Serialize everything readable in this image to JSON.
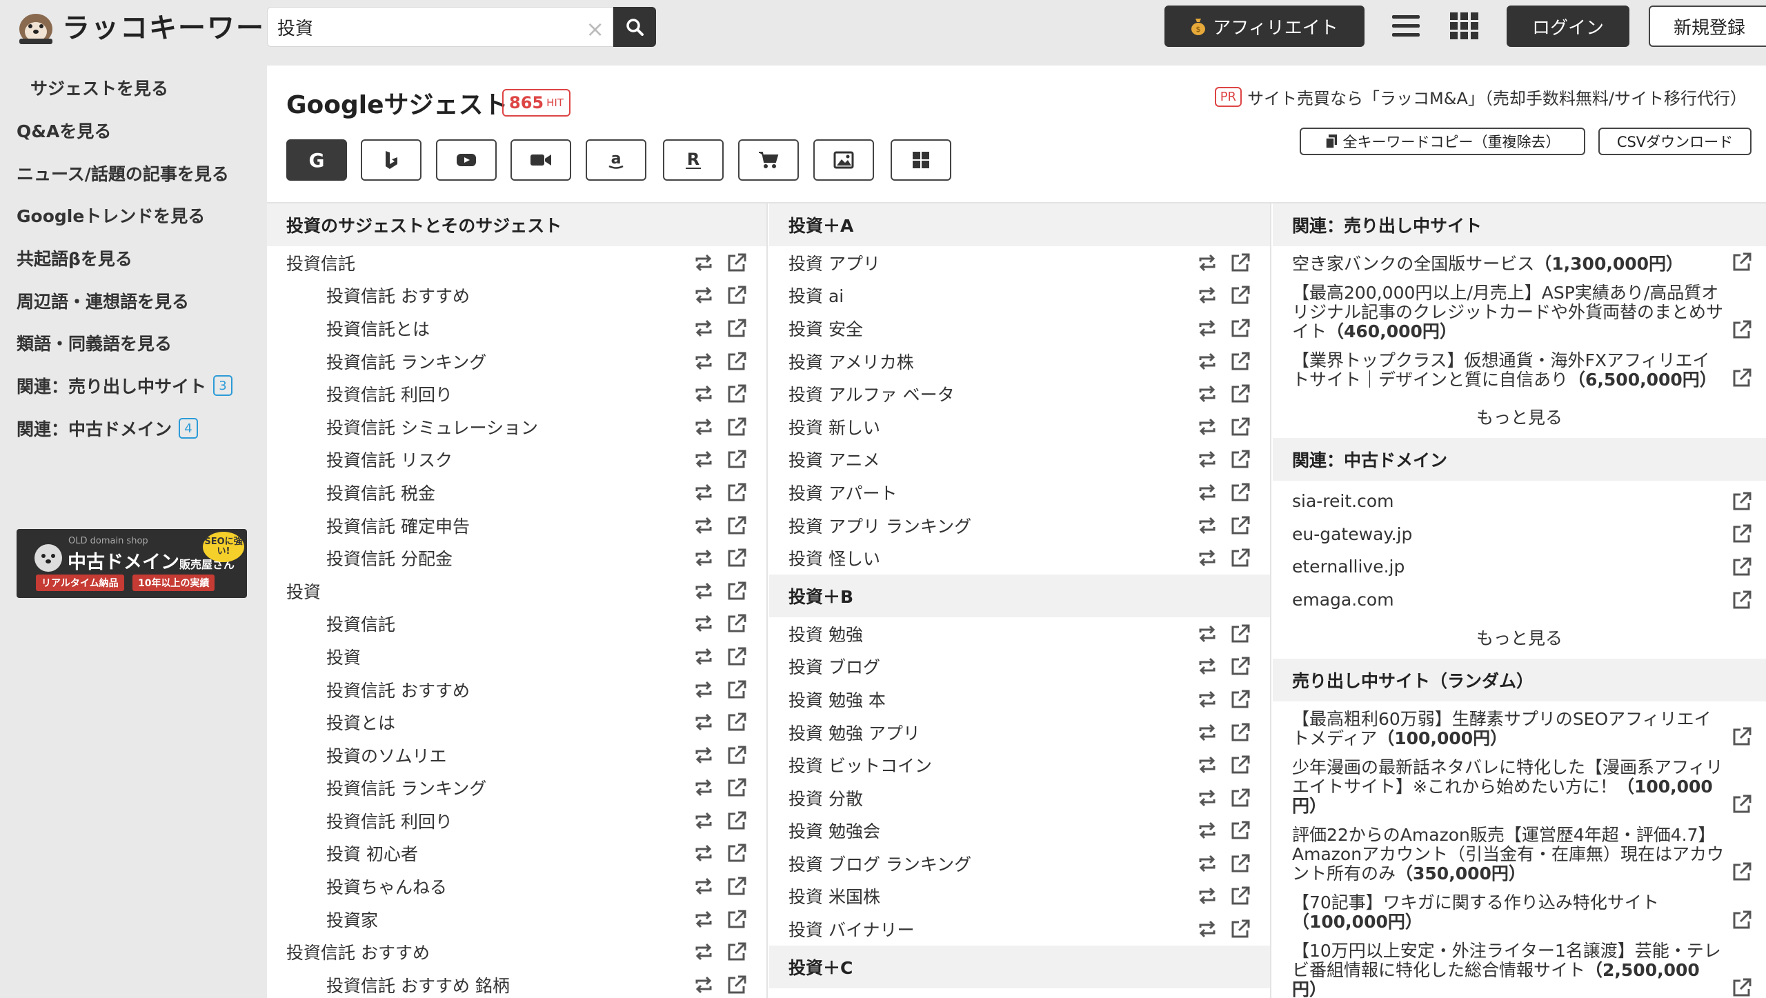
{
  "header": {
    "logo_text": "ラッコキーワード",
    "search_value": "投資",
    "affiliate_label": "アフィリエイト",
    "login_label": "ログイン",
    "signup_label": "新規登録"
  },
  "sidebar": {
    "items": [
      {
        "label": "サジェストを見る"
      },
      {
        "label": "Q&Aを見る"
      },
      {
        "label": "ニュース/話題の記事を見る"
      },
      {
        "label": "Googleトレンドを見る"
      },
      {
        "label": "共起語βを見る"
      },
      {
        "label": "周辺語・連想語を見る"
      },
      {
        "label": "類語・同義語を見る"
      },
      {
        "label": "関連：売り出し中サイト",
        "badge": "3"
      },
      {
        "label": "関連：中古ドメイン",
        "badge": "4"
      }
    ],
    "banner": {
      "sub": "OLD domain shop",
      "title": "中古ドメイン",
      "title_small": "販売屋さん",
      "seo": "SEOに強い!",
      "tag1": "リアルタイム納品",
      "tag2": "10年以上の実績"
    }
  },
  "main": {
    "title": "Googleサジェスト",
    "hit_count": "865",
    "hit_unit": "HIT",
    "pr_badge": "PR",
    "pr_text": "サイト売買なら「ラッコM&A」（売却手数料無料/サイト移行代行）",
    "copy_all_label": "全キーワードコピー（重複除去）",
    "csv_label": "CSVダウンロード",
    "engines": [
      "G",
      "b",
      "yt",
      "video",
      "a",
      "R",
      "cart",
      "image",
      "win"
    ]
  },
  "col1": {
    "heading": "投資のサジェストとそのサジェスト",
    "rows": [
      {
        "text": "投資信託",
        "sub": false
      },
      {
        "text": "投資信託 おすすめ",
        "sub": true
      },
      {
        "text": "投資信託とは",
        "sub": true
      },
      {
        "text": "投資信託 ランキング",
        "sub": true
      },
      {
        "text": "投資信託 利回り",
        "sub": true
      },
      {
        "text": "投資信託 シミュレーション",
        "sub": true
      },
      {
        "text": "投資信託 リスク",
        "sub": true
      },
      {
        "text": "投資信託 税金",
        "sub": true
      },
      {
        "text": "投資信託 確定申告",
        "sub": true
      },
      {
        "text": "投資信託 分配金",
        "sub": true
      },
      {
        "text": "投資",
        "sub": false
      },
      {
        "text": "投資信託",
        "sub": true
      },
      {
        "text": "投資",
        "sub": true
      },
      {
        "text": "投資信託 おすすめ",
        "sub": true
      },
      {
        "text": "投資とは",
        "sub": true
      },
      {
        "text": "投資のソムリエ",
        "sub": true
      },
      {
        "text": "投資信託 ランキング",
        "sub": true
      },
      {
        "text": "投資信託 利回り",
        "sub": true
      },
      {
        "text": "投資 初心者",
        "sub": true
      },
      {
        "text": "投資ちゃんねる",
        "sub": true
      },
      {
        "text": "投資家",
        "sub": true
      },
      {
        "text": "投資信託 おすすめ",
        "sub": false
      },
      {
        "text": "投資信託 おすすめ 銘柄",
        "sub": true
      }
    ]
  },
  "col2": {
    "sections": [
      {
        "heading": "投資＋A",
        "rows": [
          "投資 アプリ",
          "投資 ai",
          "投資 安全",
          "投資 アメリカ株",
          "投資 アルファ ベータ",
          "投資 新しい",
          "投資 アニメ",
          "投資 アパート",
          "投資 アプリ ランキング",
          "投資 怪しい"
        ]
      },
      {
        "heading": "投資＋B",
        "rows": [
          "投資 勉強",
          "投資 ブログ",
          "投資 勉強 本",
          "投資 勉強 アプリ",
          "投資 ビットコイン",
          "投資 分散",
          "投資 勉強会",
          "投資 ブログ ランキング",
          "投資 米国株",
          "投資 バイナリー"
        ]
      },
      {
        "heading": "投資＋C",
        "rows": []
      }
    ]
  },
  "col3": {
    "sites_heading": "関連：売り出し中サイト",
    "sites": [
      {
        "text": "空き家バンクの全国版サービス",
        "price": "（1,300,000円）"
      },
      {
        "text": "【最高200,000円以上/月売上】ASP実績あり/高品質オリジナル記事のクレジットカードや外貨両替のまとめサイト",
        "price": "（460,000円）"
      },
      {
        "text": "【業界トップクラス】仮想通貨・海外FXアフィリエイトサイト｜デザインと質に自信あり",
        "price": "（6,500,000円）"
      }
    ],
    "more1": "もっと見る",
    "domains_heading": "関連：中古ドメイン",
    "domains": [
      "sia-reit.com",
      "eu-gateway.jp",
      "eternallive.jp",
      "emaga.com"
    ],
    "more2": "もっと見る",
    "random_heading": "売り出し中サイト（ランダム）",
    "random": [
      {
        "text": "【最高粗利60万弱】生酵素サプリのSEOアフィリエイトメディア",
        "price": "（100,000円）"
      },
      {
        "text": "少年漫画の最新話ネタバレに特化した【漫画系アフィリエイトサイト】※これから始めたい方に！",
        "price": "（100,000円）"
      },
      {
        "text": "評価22からのAmazon販売【運営歴4年超・評価4.7】Amazonアカウント（引当金有・在庫無）現在はアカウント所有のみ",
        "price": "（350,000円）"
      },
      {
        "text": "【70記事】ワキガに関する作り込み特化サイト",
        "price": "（100,000円）"
      },
      {
        "text": "【10万円以上安定・外注ライター1名譲渡】芸能・テレビ番組情報に特化した総合情報サイト",
        "price": "（2,500,000円）"
      }
    ]
  }
}
